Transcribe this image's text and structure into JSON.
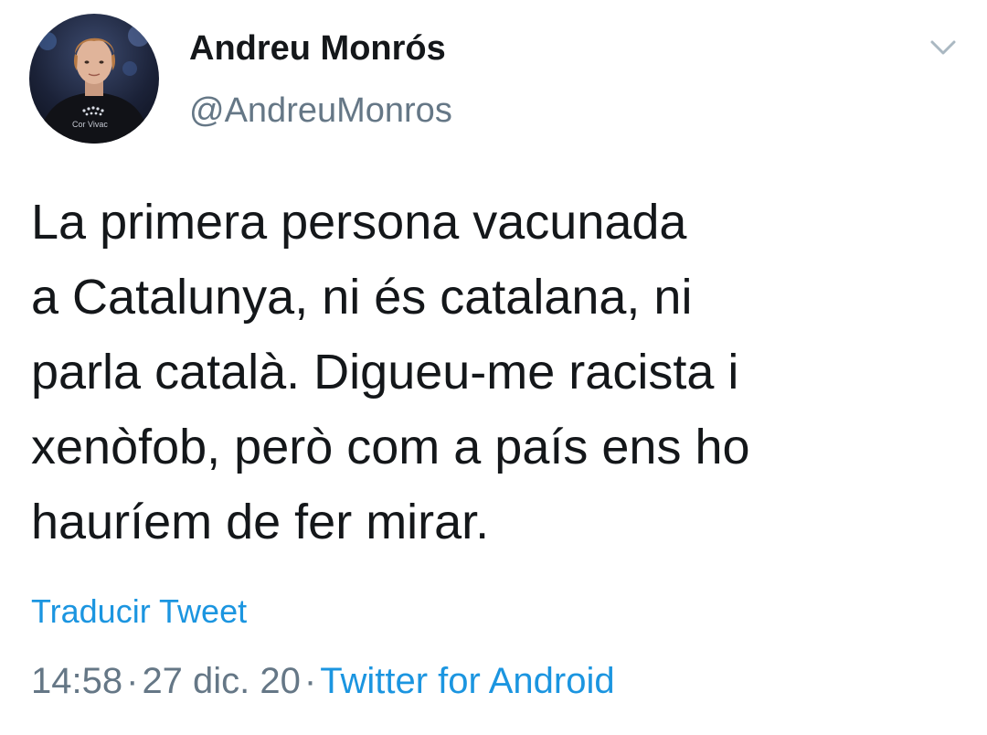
{
  "tweet": {
    "author": {
      "display_name": "Andreu Monrós",
      "handle": "@AndreuMonros",
      "avatar_caption": "Cor Vivac"
    },
    "text_lines": [
      "La primera persona vacunada",
      "a Catalunya, ni és catalana, ni",
      "parla català. Digueu-me racista i",
      "xenòfob, però com a país ens ho",
      "hauríem de fer mirar."
    ],
    "translate_label": "Traducir Tweet",
    "time": "14:58",
    "date": "27 dic. 20",
    "separator": "·",
    "source": "Twitter for Android",
    "menu_icon": "chevron-down-icon"
  },
  "colors": {
    "text_primary": "#14171a",
    "text_secondary": "#657786",
    "link": "#1b95e0",
    "background": "#ffffff"
  }
}
